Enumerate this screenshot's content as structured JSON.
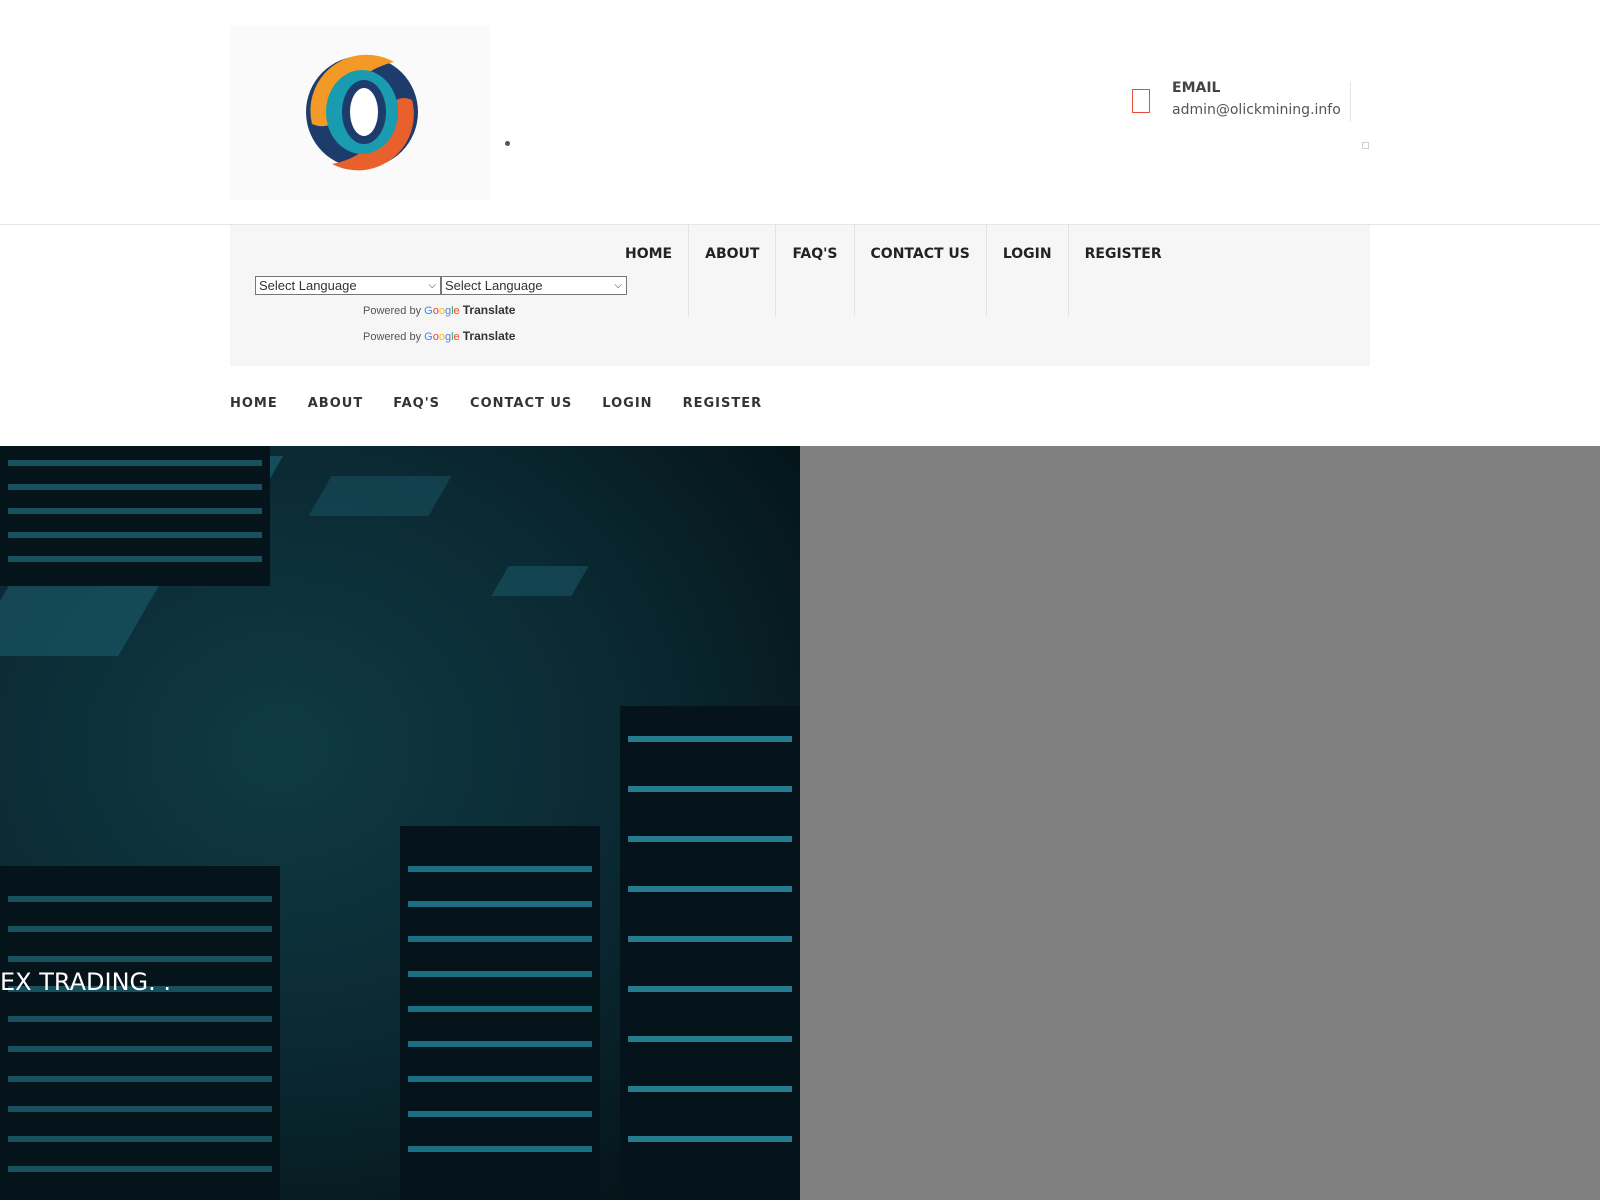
{
  "header": {
    "logo_icon": "olick-mining-logo",
    "email_icon": "envelope-icon",
    "email_title": "EMAIL",
    "email_value": "admin@olickmining.info"
  },
  "nav_panel": {
    "items": [
      {
        "label": "HOME"
      },
      {
        "label": "ABOUT"
      },
      {
        "label": "FAQ'S"
      },
      {
        "label": "CONTACT US"
      },
      {
        "label": "LOGIN"
      },
      {
        "label": "REGISTER"
      }
    ],
    "language_selects": [
      {
        "value": "Select Language"
      },
      {
        "value": "Select Language"
      }
    ],
    "powered_by": [
      {
        "prefix": "Powered by",
        "brand": "Google",
        "suffix": "Translate"
      },
      {
        "prefix": "Powered by",
        "brand": "Google",
        "suffix": "Translate"
      }
    ]
  },
  "nav_main": {
    "items": [
      {
        "label": "HOME"
      },
      {
        "label": "ABOUT"
      },
      {
        "label": "FAQ'S"
      },
      {
        "label": "CONTACT US"
      },
      {
        "label": "LOGIN"
      },
      {
        "label": "REGISTER"
      }
    ]
  },
  "hero": {
    "text": "EX TRADING. .",
    "overlay_color": "#808080"
  },
  "colors": {
    "accent_orange": "#f39a26",
    "accent_red": "#e74c3c",
    "teal": "#1a9cb0",
    "navy": "#1d3c6b"
  }
}
